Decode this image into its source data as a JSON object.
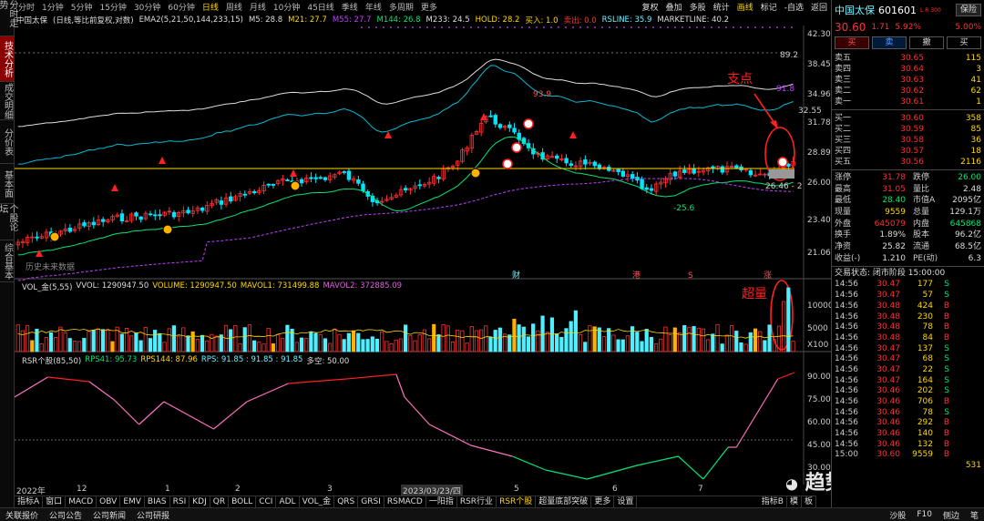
{
  "left_tabs": [
    "分时走势",
    "技术分析",
    "成交明细",
    "分价表",
    "基本面",
    "个股论坛",
    "综合基本"
  ],
  "active_left_tab": 1,
  "periods": [
    "分时",
    "1分钟",
    "5分钟",
    "15分钟",
    "30分钟",
    "60分钟",
    "日线",
    "周线",
    "月线",
    "10分钟",
    "45日线",
    "季线",
    "年线",
    "多周期",
    "更多"
  ],
  "active_period": "日线",
  "top_right": [
    "复权",
    "叠加",
    "多股",
    "统计",
    "画线",
    "标记",
    "-自选",
    "返回"
  ],
  "info": {
    "name": "中国太保",
    "mode": "(日线,等比前复权,对数)",
    "ema": "EMA2(5,21,50,144,233,15)",
    "ma5": "M5: 28.8",
    "ma21": "M21: 27.7",
    "ma55": "M55: 27.7",
    "ma144": "M144: 26.8",
    "ma233": "M233: 24.5",
    "hold": "HOLD: 28.2",
    "buy": "买入: 1.0",
    "sell": "卖出: 0.0",
    "rsline": "RSLINE: 35.9",
    "mkt": "MARKETLINE: 40.2"
  },
  "price_axis": [
    "42.30",
    "38.45",
    "34.96",
    "31.78",
    "28.89",
    "26.00",
    "23.40",
    "21.06"
  ],
  "price_labels": {
    "line_high": "89.2",
    "line_peak": "91.8",
    "level": "32.55",
    "support": "26.46 - 2"
  },
  "annot_labels": {
    "peak": "93.9",
    "low": "-25.6",
    "footnote": "历史未来数据",
    "cai": "财",
    "gang": "港",
    "s": "S",
    "zhang": "涨"
  },
  "annotations": {
    "zhidian": "支点",
    "chaoliang": "超量"
  },
  "vol_info": {
    "title": "VOL_金(5,55)",
    "vvol": "VVOL: 1290947.50",
    "volume": "VOLUME: 1290947.50",
    "mavol1": "MAVOL1: 731499.88",
    "mavol2": "MAVOL2: 372885.09"
  },
  "vol_axis": [
    "10000",
    "5000",
    "X100"
  ],
  "rsi_info": {
    "title": "RSR个股(85,50)",
    "rps41": "RPS41: 95.73",
    "rps144": "RPS144: 87.96",
    "rps": "RPS: 91.85 : 91.85 : 91.85",
    "ks": "多空: 50.00"
  },
  "rsi_axis": [
    "90.00",
    "75.00",
    "60.00",
    "45.00",
    "30.00"
  ],
  "x_labels": [
    "2022年",
    "12",
    "1",
    "2",
    "3",
    "2023/03/23/四",
    "5",
    "6",
    "7"
  ],
  "bottom_tabs": [
    "指标A",
    "窗口",
    "MACD",
    "OBV",
    "EMV",
    "BIAS",
    "RSI",
    "KDJ",
    "QR",
    "BOLL",
    "CCI",
    "ADL",
    "VOL_金",
    "QRS",
    "GRSI",
    "RSMACD",
    "一阳指",
    "RSR行业",
    "RSR个股",
    "超量底部突破",
    "更多",
    "设置"
  ],
  "active_bottom_tab": "RSR个股",
  "bottom_right": [
    "指标B",
    "模",
    "板"
  ],
  "status": [
    "关联报价",
    "公司公告",
    "公司新闻",
    "公司研报"
  ],
  "status_right": [
    "沙股",
    "F10",
    "侧边",
    "笔"
  ],
  "rp": {
    "name": "中国太保",
    "code": "601601",
    "badge": "L R 300",
    "btn": "保险",
    "price": "30.60",
    "chg": "1.71",
    "pct": "5.92%",
    "side_pct": "5.00%",
    "btns": [
      "买",
      "卖",
      "撤",
      "买"
    ],
    "asks": [
      [
        "卖五",
        "30.65",
        "115"
      ],
      [
        "卖四",
        "30.64",
        "3"
      ],
      [
        "卖三",
        "30.63",
        "41"
      ],
      [
        "卖二",
        "30.62",
        "62"
      ],
      [
        "卖一",
        "30.61",
        "1"
      ]
    ],
    "bids": [
      [
        "买一",
        "30.60",
        "358"
      ],
      [
        "买二",
        "30.59",
        "85"
      ],
      [
        "买三",
        "30.58",
        "36"
      ],
      [
        "买四",
        "30.57",
        "18"
      ],
      [
        "买五",
        "30.56",
        "2116"
      ]
    ],
    "stats": [
      [
        "涨停",
        "31.78",
        "跌停",
        "26.00"
      ],
      [
        "最高",
        "31.05",
        "量比",
        "2.48"
      ],
      [
        "最低",
        "28.40",
        "市值A",
        "2095亿"
      ],
      [
        "现量",
        "9559",
        "总量",
        "129.1万"
      ],
      [
        "外盘",
        "645079",
        "内盘",
        "645868"
      ],
      [
        "换手",
        "1.89%",
        "股本",
        "96.2亿"
      ],
      [
        "净资",
        "25.82",
        "流通",
        "68.5亿"
      ],
      [
        "收益(-)",
        "1.210",
        "PE(动)",
        "6.3"
      ]
    ],
    "state": "交易状态: 闭市阶段 15:00:00",
    "ticks": [
      [
        "14:56",
        "30.47",
        "177",
        "S"
      ],
      [
        "14:56",
        "30.47",
        "57",
        "S"
      ],
      [
        "14:56",
        "30.48",
        "424",
        "B"
      ],
      [
        "14:56",
        "30.48",
        "230",
        "B"
      ],
      [
        "14:56",
        "30.48",
        "78",
        "B"
      ],
      [
        "14:56",
        "30.48",
        "84",
        "B"
      ],
      [
        "14:56",
        "30.47",
        "137",
        "S"
      ],
      [
        "14:56",
        "30.47",
        "68",
        "S"
      ],
      [
        "14:56",
        "30.47",
        "22",
        "S"
      ],
      [
        "14:56",
        "30.47",
        "164",
        "S"
      ],
      [
        "14:56",
        "30.46",
        "202",
        "S"
      ],
      [
        "14:56",
        "30.46",
        "706",
        "B"
      ],
      [
        "14:56",
        "30.46",
        "78",
        "S"
      ],
      [
        "14:56",
        "30.46",
        "292",
        "B"
      ],
      [
        "14:56",
        "30.46",
        "140",
        "B"
      ],
      [
        "14:56",
        "30.46",
        "132",
        "B"
      ],
      [
        "15:00",
        "30.60",
        "9559",
        "B"
      ]
    ],
    "tick_extra": "531"
  },
  "watermark": "趋势一阳指",
  "colors": {
    "up": "#ff3030",
    "down": "#00e5ff",
    "ma": "#ffd700",
    "green": "#00e676",
    "purple": "#c040ff"
  }
}
